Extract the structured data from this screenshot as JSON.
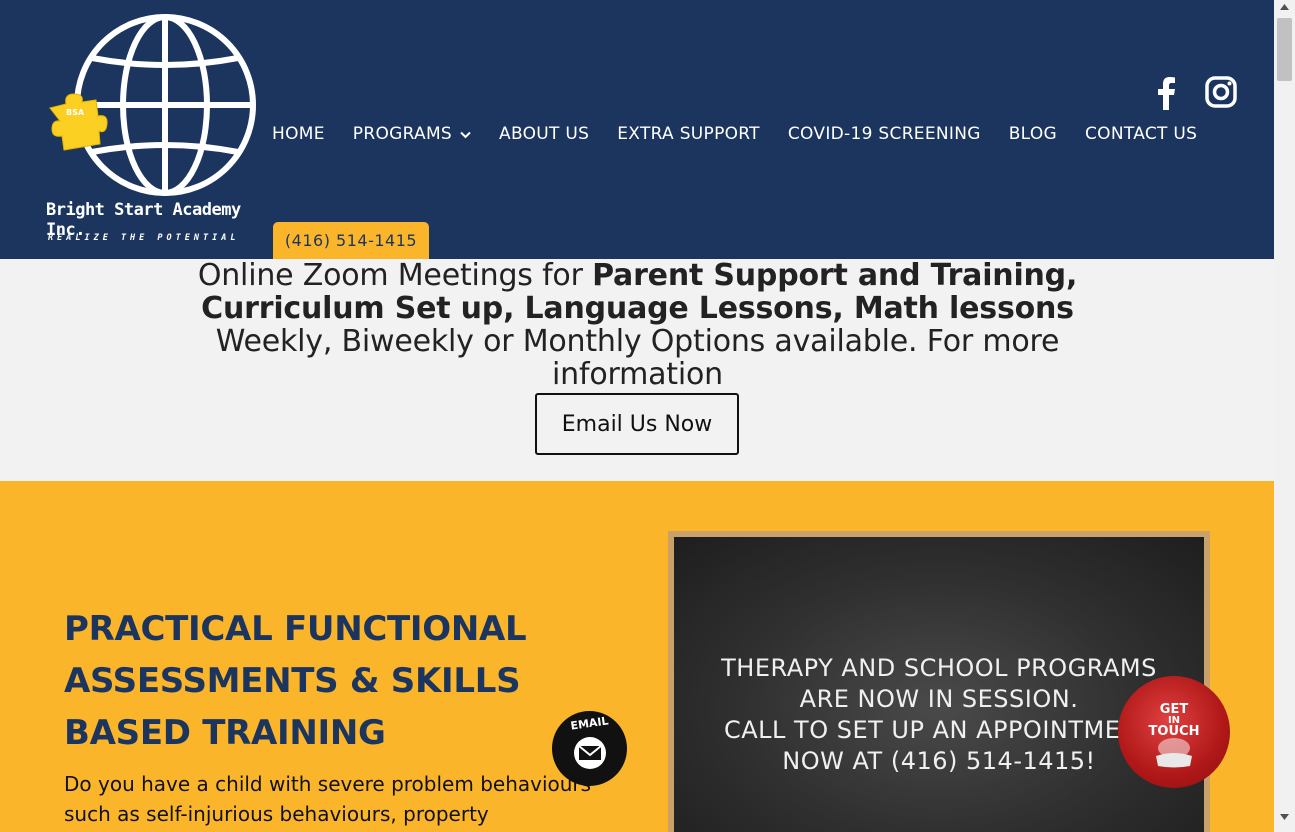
{
  "logo": {
    "badge": "BSA",
    "name": "Bright Start Academy Inc.",
    "tagline": "REALIZE THE POTENTIAL"
  },
  "nav": {
    "items": [
      {
        "label": "HOME"
      },
      {
        "label": "PROGRAMS",
        "has_dropdown": true
      },
      {
        "label": "ABOUT US"
      },
      {
        "label": "EXTRA SUPPORT"
      },
      {
        "label": "COVID-19 SCREENING"
      },
      {
        "label": "BLOG"
      },
      {
        "label": "CONTACT US"
      }
    ],
    "phone": "(416) 514-1415"
  },
  "social": {
    "icons": [
      "facebook-icon",
      "instagram-icon"
    ]
  },
  "banner": {
    "t1": "Online Zoom Meetings for ",
    "b1": "Parent Support and Training, Curriculum Set up,  Language Lessons, Math lessons",
    "t2": " Weekly, Biweekly or Monthly Options available. For more information",
    "button": "Email Us Now"
  },
  "section": {
    "heading": "PRACTICAL FUNCTIONAL ASSESSMENTS & SKILLS BASED TRAINING",
    "paragraph": "Do you have a child with severe problem behaviours such as self-injurious behaviours, property destruction",
    "board_lines": [
      "THERAPY AND SCHOOL PROGRAMS",
      "ARE NOW IN SESSION.",
      "CALL TO SET UP AN APPOINTMENT",
      "NOW AT (416) 514-1415!"
    ]
  },
  "widgets": {
    "email_label": "EMAIL",
    "get_in_touch": [
      "GET",
      "IN",
      "TOUCH"
    ]
  },
  "colors": {
    "header_bg": "#1c355e",
    "accent_yellow": "#fbb52b",
    "banner_bg": "#f2f2f2"
  }
}
